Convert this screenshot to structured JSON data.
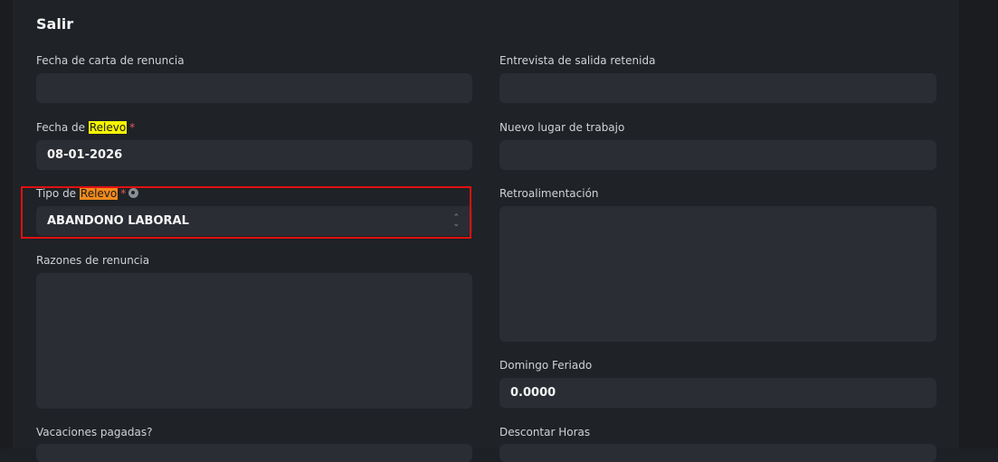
{
  "section": {
    "title": "Salir"
  },
  "left": {
    "fecha_carta": {
      "label": "Fecha de carta de renuncia",
      "value": ""
    },
    "fecha_relevo": {
      "label_prefix": "Fecha de ",
      "label_highlight": "Relevo",
      "required": "*",
      "value": "08-01-2026"
    },
    "tipo_relevo": {
      "label_prefix": "Tipo de ",
      "label_highlight": "Relevo",
      "required": "*",
      "value": "ABANDONO LABORAL"
    },
    "razones": {
      "label": "Razones de renuncia",
      "value": ""
    },
    "vacaciones": {
      "label": "Vacaciones pagadas?"
    }
  },
  "right": {
    "entrevista": {
      "label": "Entrevista de salida retenida",
      "value": ""
    },
    "nuevo_lugar": {
      "label": "Nuevo lugar de trabajo",
      "value": ""
    },
    "retro": {
      "label": "Retroalimentación",
      "value": ""
    },
    "domingo": {
      "label": "Domingo Feriado",
      "value": "0.0000"
    },
    "descontar": {
      "label": "Descontar Horas"
    }
  },
  "colors": {
    "highlight_yellow": "#f5f500",
    "highlight_orange": "#f28a1e",
    "required": "#e35a5a",
    "focus_box": "#e01010"
  }
}
